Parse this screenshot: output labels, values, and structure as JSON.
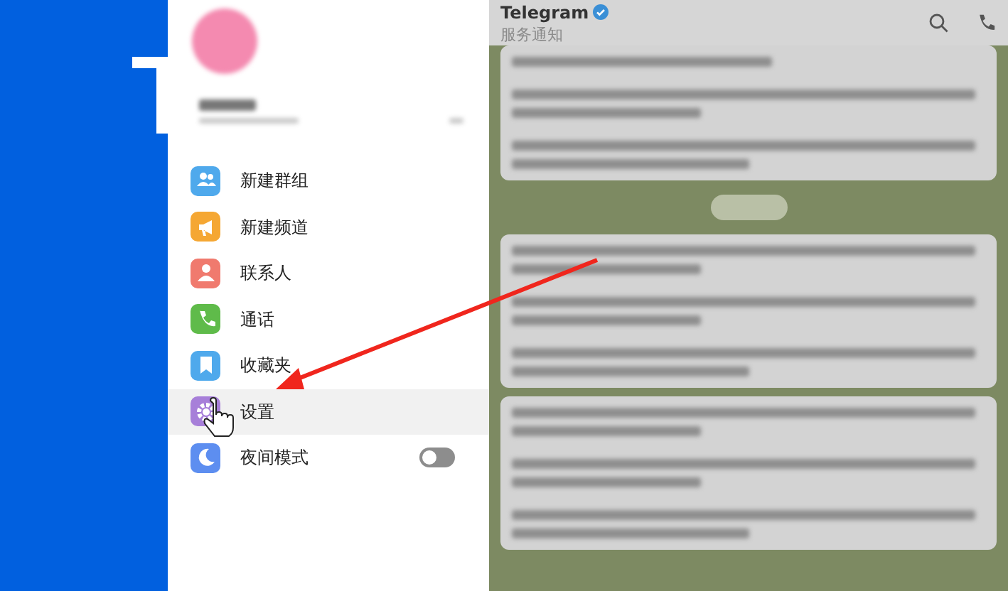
{
  "menu": {
    "items": [
      {
        "label": "新建群组",
        "color": "#4fa9ec",
        "selected": false,
        "kind": "link"
      },
      {
        "label": "新建频道",
        "color": "#f5a733",
        "selected": false,
        "kind": "link"
      },
      {
        "label": "联系人",
        "color": "#f07a6e",
        "selected": false,
        "kind": "link"
      },
      {
        "label": "通话",
        "color": "#5fbb4a",
        "selected": false,
        "kind": "link"
      },
      {
        "label": "收藏夹",
        "color": "#4fa9ec",
        "selected": false,
        "kind": "link"
      },
      {
        "label": "设置",
        "color": "#a77fd9",
        "selected": true,
        "kind": "link"
      },
      {
        "label": "夜间模式",
        "color": "#5d8ef0",
        "selected": false,
        "kind": "toggle",
        "on": false
      }
    ]
  },
  "chat": {
    "title": "Telegram",
    "verified": true,
    "subtitle": "服务通知"
  }
}
